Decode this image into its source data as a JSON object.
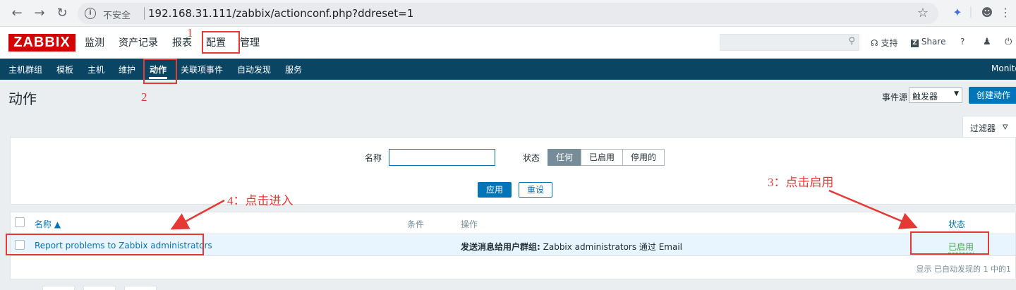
{
  "browser": {
    "insecure_label": "不安全",
    "url": "192.168.31.111/zabbix/actionconf.php?ddreset=1"
  },
  "header": {
    "logo": "ZABBIX",
    "menu": [
      "监测",
      "资产记录",
      "报表",
      "配置",
      "管理"
    ],
    "support": "支持",
    "share": "Share",
    "help": "?"
  },
  "subnav": {
    "items": [
      "主机群组",
      "模板",
      "主机",
      "维护",
      "动作",
      "关联项事件",
      "自动发现",
      "服务"
    ],
    "right_text": "Monito"
  },
  "page": {
    "title": "动作",
    "event_source_label": "事件源",
    "event_source_value": "触发器",
    "create_button": "创建动作"
  },
  "filter": {
    "tab_label": "过滤器",
    "name_label": "名称",
    "name_value": "",
    "status_label": "状态",
    "status_options": [
      "任何",
      "已启用",
      "停用的"
    ],
    "status_selected": "任何",
    "apply": "应用",
    "reset": "重设"
  },
  "table": {
    "headers": {
      "name": "名称 ▲",
      "conditions": "条件",
      "operations": "操作",
      "status": "状态"
    },
    "rows": [
      {
        "name": "Report problems to Zabbix administrators",
        "operation_bold": "发送消息给用户群组:",
        "operation_rest": " Zabbix administrators 通过 Email",
        "status": "已启用"
      }
    ],
    "footer": "显示 已自动发现的 1 中的1"
  },
  "annotations": {
    "n1": "1",
    "n2": "2",
    "n3": "3：点击启用",
    "n4": "4：点击进入"
  },
  "colors": {
    "accent": "#0275b8",
    "nav_bg": "#0b4564",
    "annotation": "#e53935",
    "enabled": "#429e47",
    "logo": "#d40000"
  }
}
